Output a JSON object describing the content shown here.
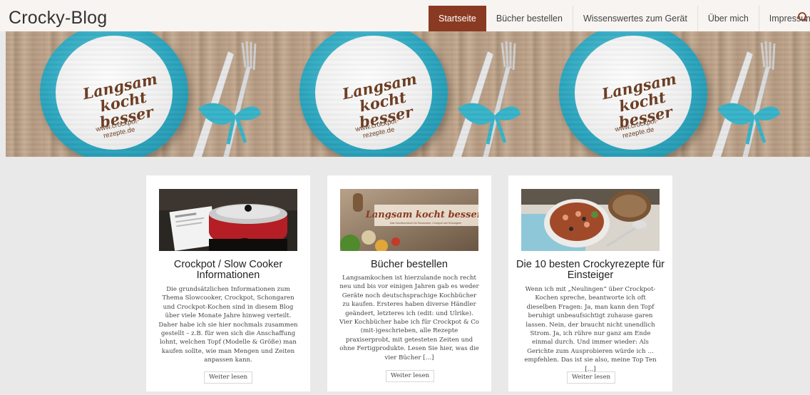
{
  "site": {
    "title": "Crocky-Blog"
  },
  "nav": {
    "items": [
      {
        "label": "Startseite",
        "active": true
      },
      {
        "label": "Bücher bestellen",
        "active": false
      },
      {
        "label": "Wissenswertes zum Gerät",
        "active": false
      },
      {
        "label": "Über mich",
        "active": false
      },
      {
        "label": "Impressum",
        "active": false
      }
    ],
    "search_icon": "search-icon",
    "active_color": "#8a3a22"
  },
  "banner": {
    "plate_line1": "Langsam",
    "plate_line2": "kocht besser",
    "plate_url": "www.crockpot-\nrezepte.de"
  },
  "cards": [
    {
      "title": "Crockpot / Slow Cooker Informationen",
      "text": "Die grundsätzlichen Informationen zum Thema Slowcooker, Crockpot, Schongaren und Crockpot-Kochen sind in diesem Blog über viele Monate Jahre hinweg verteilt. Daher habe ich sie hier nochmals zusammen gestellt – z.B. für wen sich die Anschaffung lohnt, welchen Topf (Modelle & Größe) man kaufen sollte, wie man Mengen und Zeiten anpassen kann.",
      "button": "Weiter lesen"
    },
    {
      "title": "Bücher bestellen",
      "text": "Langsamkochen ist hierzulande noch recht neu und bis vor einigen Jahren gab es weder Geräte noch deutschsprachige Kochbücher zu kaufen. Ersteres haben diverse Händler geändert, letzteres ich (edit: und Ulrike). Vier Kochbücher habe ich für Crockpot & Co (mit-)geschrieben, alle Rezepte praxiserprobt, mit getesteten Zeiten und ohne Fertigprodukte. Lesen Sie hier, was die vier Bücher […]",
      "button": "Weiter lesen",
      "image_caption": "Langsam kocht besser!",
      "image_subcaption": "Das Grundkochbuch für Slowcooker, Crockpot und Schongarer"
    },
    {
      "title": "Die 10 besten Crockyrezepte für Einsteiger",
      "text": "Wenn ich mit „Neulingen“ über Crockpot-Kochen spreche, beantworte ich oft dieselben Fragen: Ja, man kann den Topf beruhigt unbeaufsichtigt zuhause garen lassen. Nein, der braucht nicht unendlich Strom. Ja, ich rühre nur ganz am Ende einmal durch. Und immer wieder: Als Gerichte zum Ausprobieren würde ich … empfehlen. Das ist sie also, meine Top Ten […]",
      "button": "Weiter lesen"
    }
  ]
}
